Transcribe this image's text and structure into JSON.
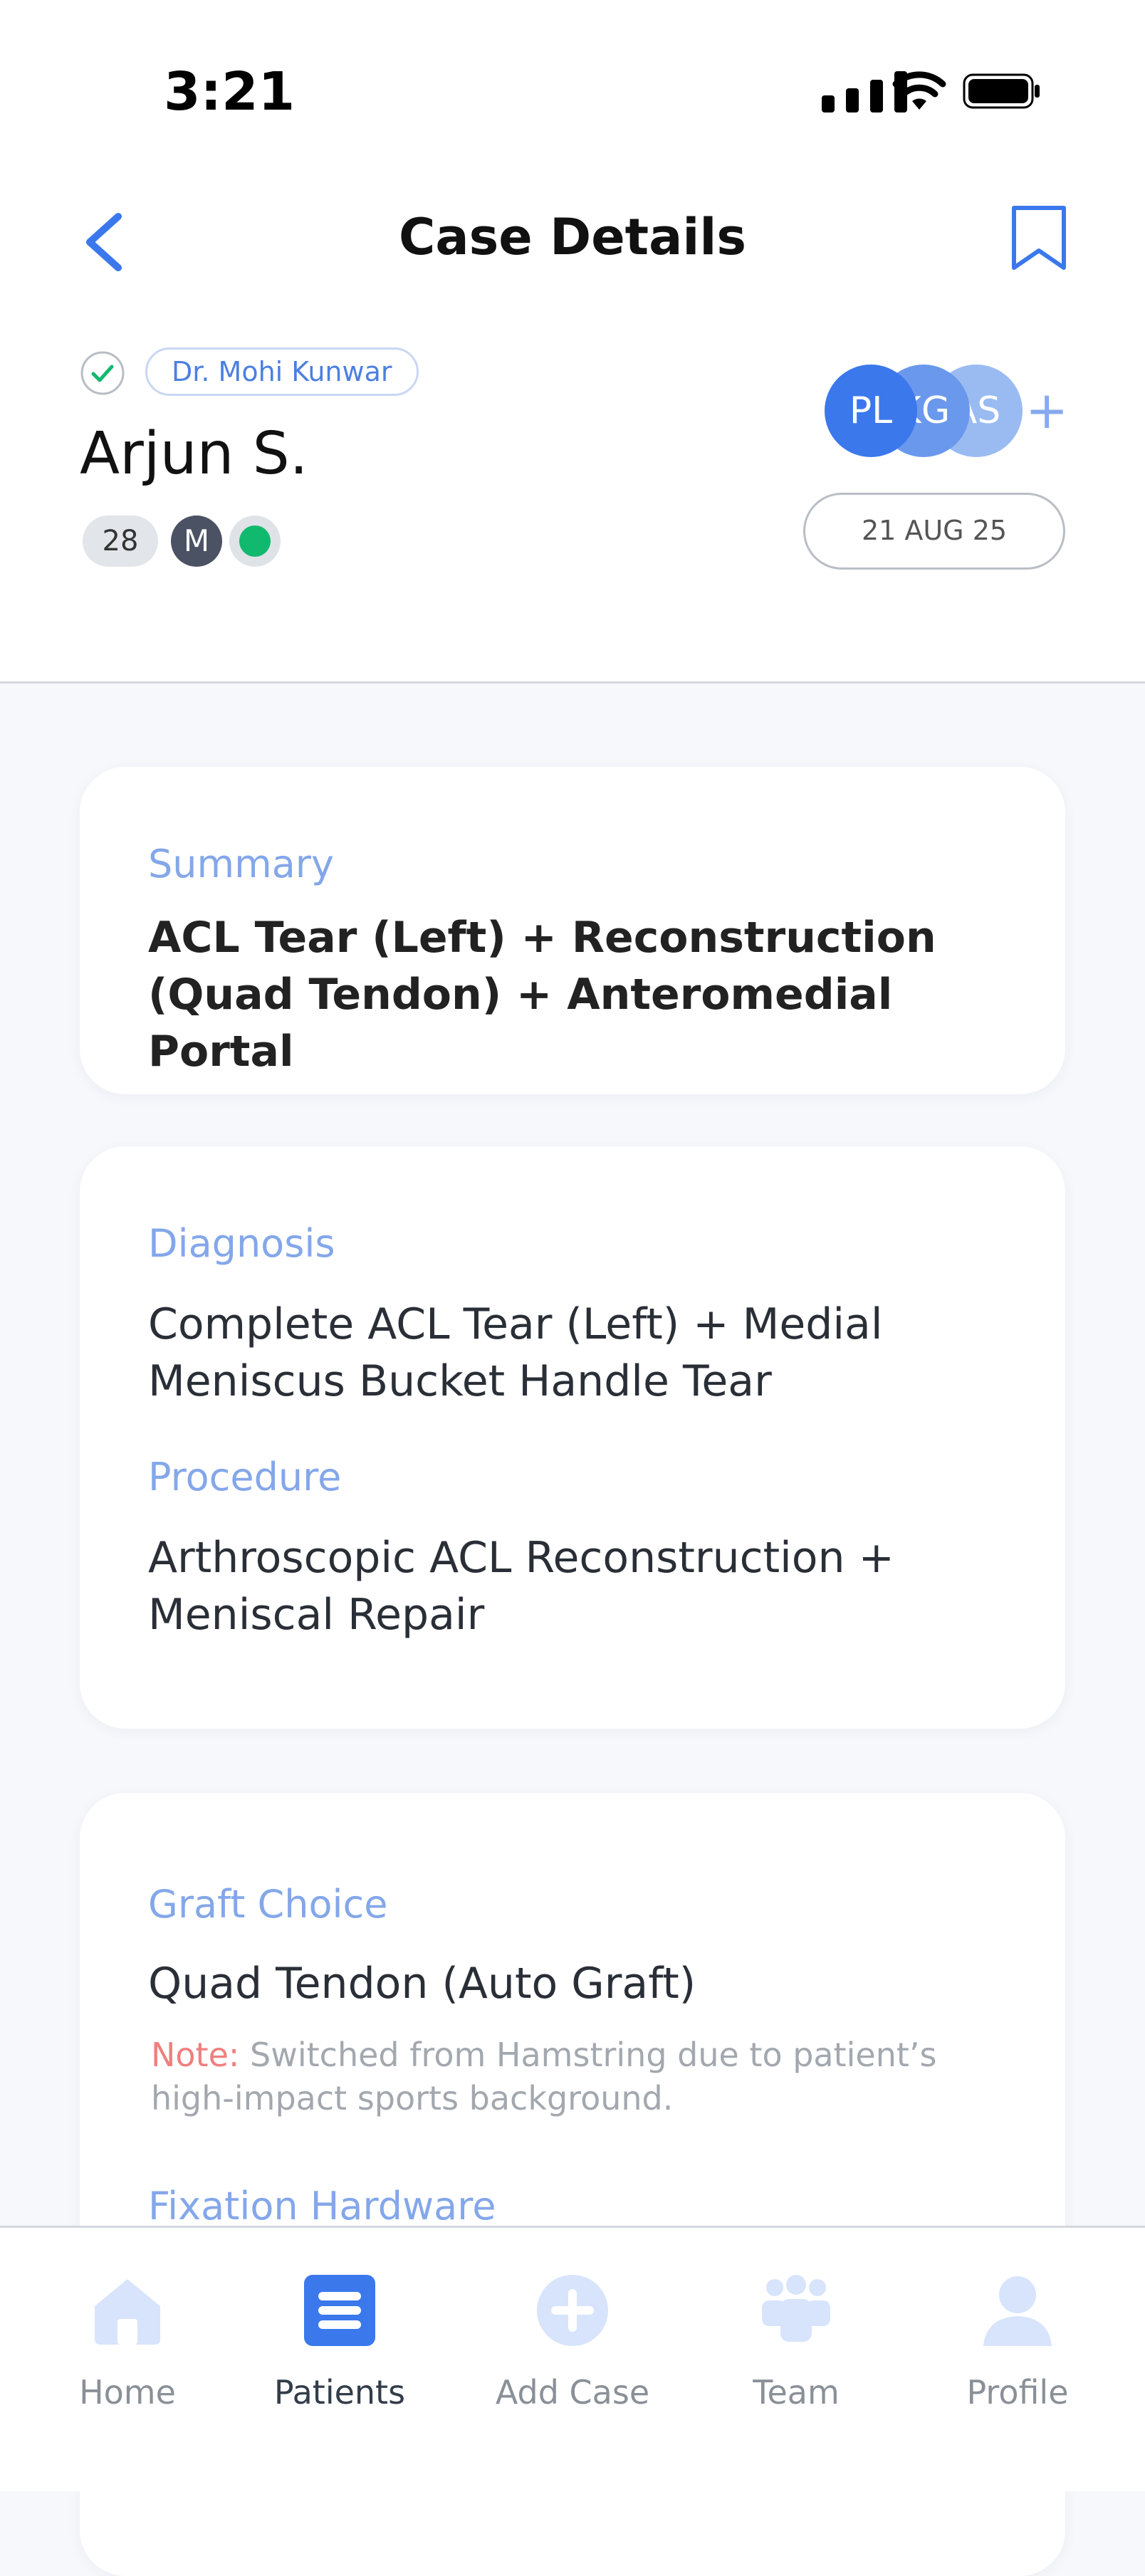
{
  "status_bar": {
    "time": "3:21"
  },
  "header": {
    "title": "Case Details"
  },
  "patient": {
    "doctor": "Dr. Mohi Kunwar",
    "name": "Arjun S.",
    "age": "28",
    "gender": "M",
    "status_color": "#11B96E"
  },
  "team": {
    "avatars": [
      "PL",
      "KG",
      "AS"
    ],
    "add_label": "+"
  },
  "case_date": "21 AUG 25",
  "summary": {
    "label": "Summary",
    "text": "ACL Tear (Left) + Reconstruction (Quad Tendon) + Anteromedial Portal"
  },
  "diagnosis": {
    "label": "Diagnosis",
    "text": "Complete ACL Tear (Left) + Medial Meniscus Bucket Handle Tear"
  },
  "procedure": {
    "label": "Procedure",
    "text": "Arthroscopic ACL Reconstruction + Meniscal Repair"
  },
  "graft": {
    "label": "Graft Choice",
    "text": "Quad Tendon (Auto Graft)",
    "note_label": "Note:",
    "note_text": "Switched from Hamstring due to patient’s high-impact sports background."
  },
  "fixation": {
    "label": "Fixation Hardware"
  },
  "nav": {
    "items": [
      {
        "label": "Home",
        "icon": "home-icon"
      },
      {
        "label": "Patients",
        "icon": "patients-list-icon",
        "active": true
      },
      {
        "label": "Add Case",
        "icon": "add-case-icon"
      },
      {
        "label": "Team",
        "icon": "team-icon"
      },
      {
        "label": "Profile",
        "icon": "profile-icon"
      }
    ]
  },
  "colors": {
    "accent": "#3A78EC",
    "label": "#84A7EA",
    "note": "#F07F7F",
    "background": "#F6F8FB"
  }
}
